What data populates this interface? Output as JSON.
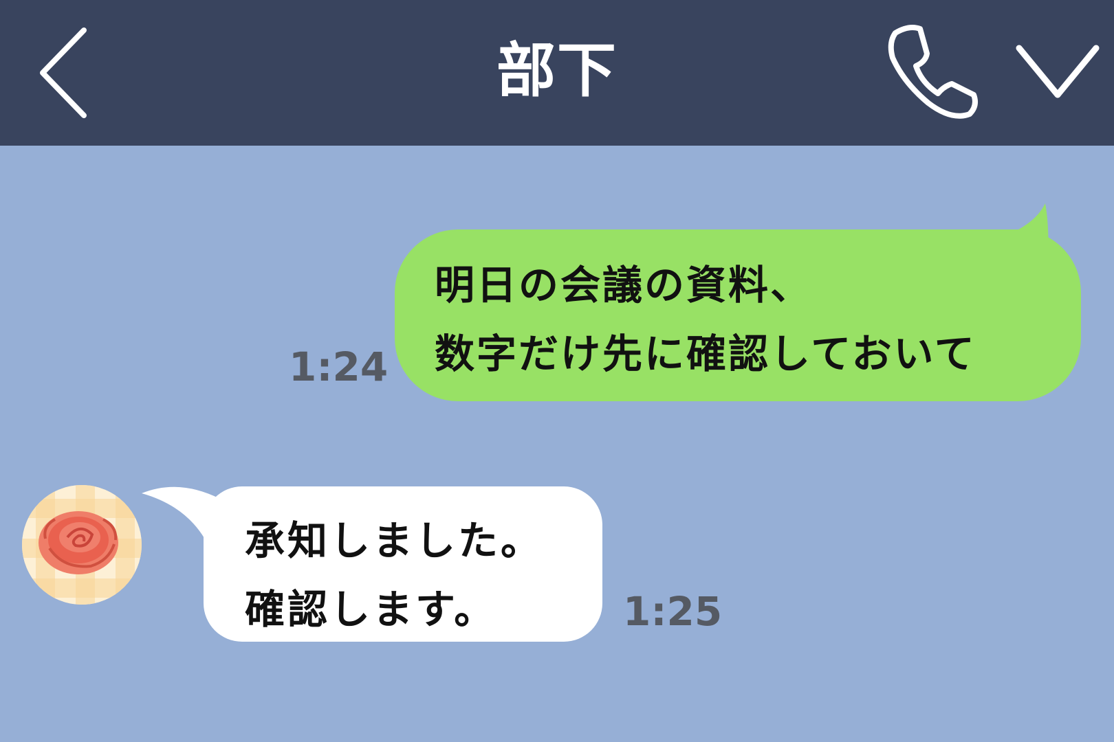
{
  "header": {
    "title": "部下",
    "back_icon": "chevron-left-icon",
    "call_icon": "phone-icon",
    "menu_icon": "chevron-down-icon"
  },
  "messages": [
    {
      "direction": "outgoing",
      "lines": [
        "明日の会議の資料、",
        "数字だけ先に確認しておいて"
      ],
      "time": "1:24"
    },
    {
      "direction": "incoming",
      "avatar_icon": "rose-avatar-icon",
      "lines": [
        "承知しました。",
        "確認します。"
      ],
      "time": "1:25"
    }
  ],
  "colors": {
    "header_bg": "#39445e",
    "chat_bg": "#96afd6",
    "outgoing_bubble": "#98e165",
    "incoming_bubble": "#ffffff",
    "timestamp": "#555a63"
  }
}
